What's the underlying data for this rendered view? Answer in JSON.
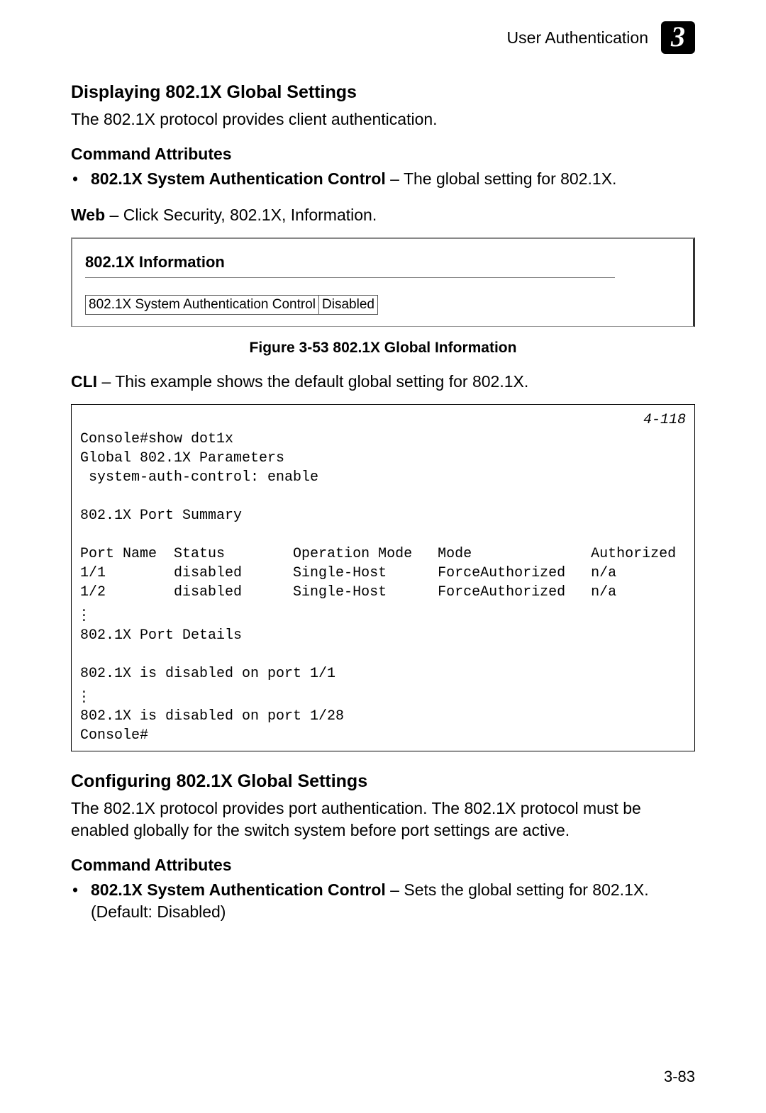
{
  "header": {
    "title": "User Authentication",
    "chapter": "3"
  },
  "section1": {
    "heading": "Displaying 802.1X Global Settings",
    "intro": "The 802.1X protocol provides client authentication.",
    "cmd_attr_label": "Command Attributes",
    "bullet_bold": "802.1X System Authentication Control",
    "bullet_rest": " – The global setting for 802.1X.",
    "web_bold": "Web",
    "web_rest": " – Click Security, 802.1X, Information."
  },
  "panel": {
    "title": "802.1X Information",
    "row_label": "802.1X System Authentication Control",
    "row_value": "Disabled"
  },
  "figure_caption": "Figure 3-53  802.1X Global Information",
  "cli": {
    "bold": "CLI",
    "rest": " – This example shows the default global setting for 802.1X.",
    "ref": "4-118",
    "line1": "Console#show dot1x",
    "line2": "Global 802.1X Parameters",
    "line3": " system-auth-control: enable",
    "line4": "",
    "line5": "802.1X Port Summary",
    "line6": "",
    "line7": "Port Name  Status        Operation Mode   Mode              Authorized",
    "line8": "1/1        disabled      Single-Host      ForceAuthorized   n/a",
    "line9": "1/2        disabled      Single-Host      ForceAuthorized   n/a",
    "line10": "802.1X Port Details",
    "line11": "",
    "line12": "802.1X is disabled on port 1/1",
    "line13": "802.1X is disabled on port 1/28",
    "line14": "Console#"
  },
  "section2": {
    "heading": "Configuring 802.1X Global Settings",
    "intro": "The 802.1X protocol provides port authentication. The 802.1X protocol must be enabled globally for the switch system before port settings are active.",
    "cmd_attr_label": "Command Attributes",
    "bullet_bold": "802.1X System Authentication Control",
    "bullet_rest": " – Sets the global setting for 802.1X. (Default: Disabled)"
  },
  "page_number": "3-83"
}
